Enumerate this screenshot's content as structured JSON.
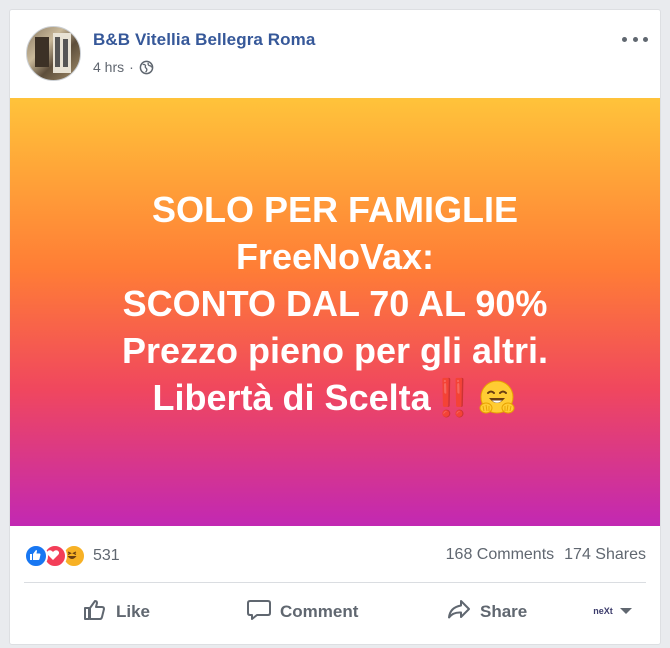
{
  "post": {
    "page_name": "B&B Vitellia Bellegra Roma",
    "timestamp": "4 hrs",
    "separator": "·",
    "privacy_icon": "globe-icon"
  },
  "banner": {
    "lines": [
      "SOLO PER FAMIGLIE",
      "FreeNoVax:",
      "SCONTO DAL 70 AL 90%",
      "Prezzo pieno per gli altri.",
      "Libertà di Scelta"
    ],
    "emoji_bang": "‼️",
    "emoji_face": "hugging-face-emoji",
    "gradient": [
      "#ffc33a",
      "#ff7d36",
      "#f0475e",
      "#c228b3"
    ]
  },
  "stats": {
    "reaction_icons": [
      "like-reaction-icon",
      "love-reaction-icon",
      "haha-reaction-icon"
    ],
    "reaction_count": "531",
    "comments": "168 Comments",
    "shares": "174 Shares"
  },
  "actions": {
    "like": "Like",
    "comment": "Comment",
    "share": "Share",
    "audience_logo": "neXt"
  },
  "colors": {
    "link": "#365899",
    "muted": "#606770",
    "like": "#1877f2",
    "love": "#f33e58",
    "haha": "#f7b125"
  }
}
